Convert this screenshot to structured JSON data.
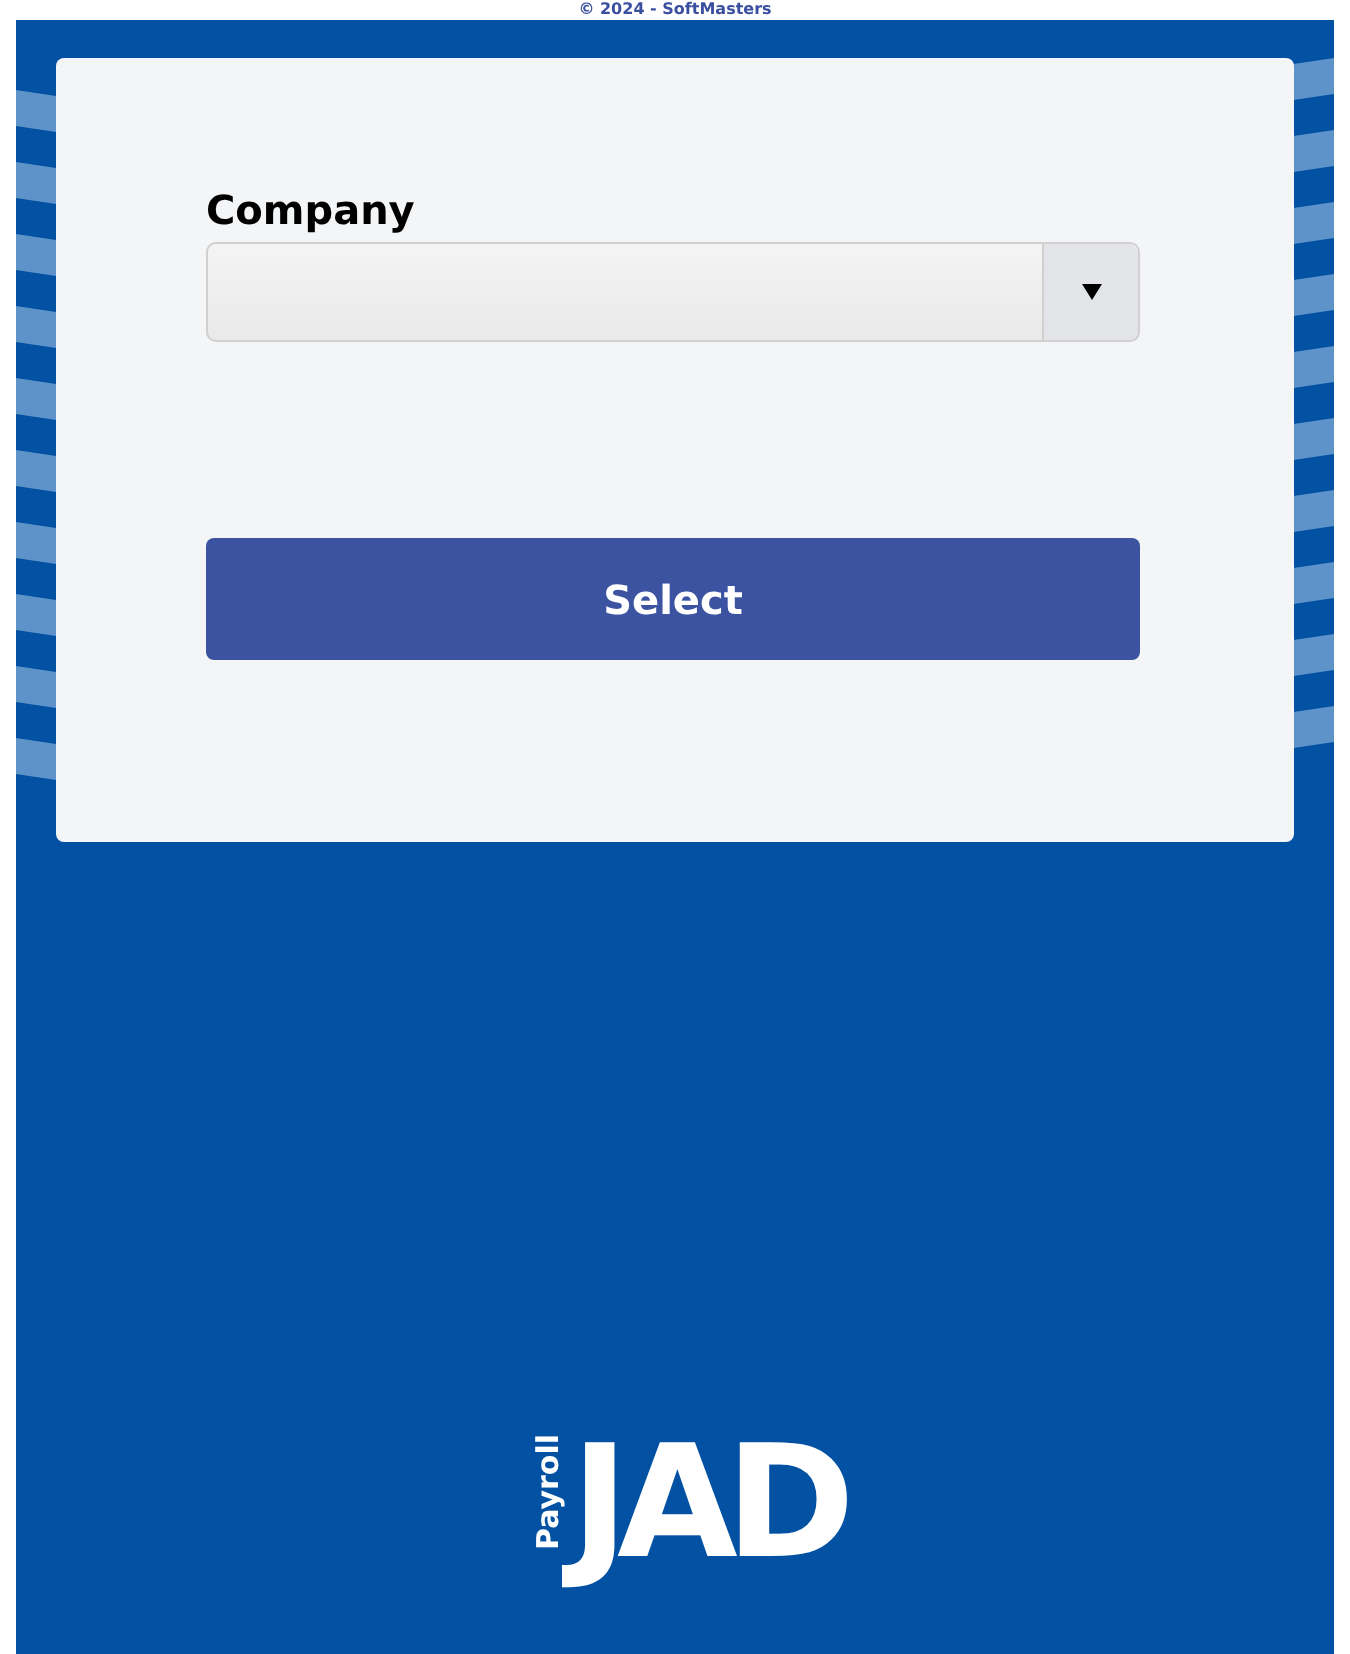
{
  "copyright": "© 2024 - SoftMasters",
  "form": {
    "label": "Company",
    "button": "Select"
  },
  "logo": {
    "mark": "JAD",
    "caption": "Payroll"
  }
}
